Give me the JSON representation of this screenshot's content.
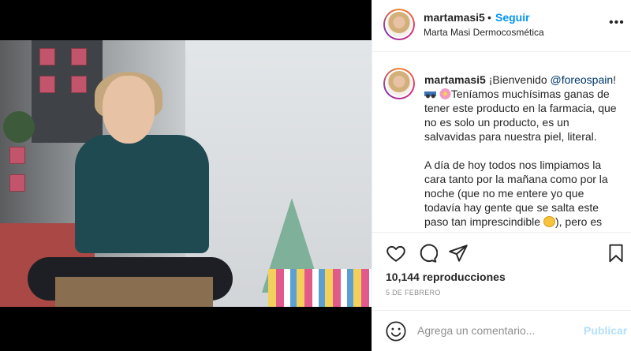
{
  "post": {
    "username": "martamasi5",
    "separator": "•",
    "follow_label": "Seguir",
    "subtitle": "Marta Masi Dermocosmética",
    "more_label": "•••"
  },
  "caption": {
    "username": "martamasi5",
    "greeting": "¡Bienvenido ",
    "mention": "@foreospain",
    "mention_end": "!",
    "line2": "Teníamos muchísimas ganas de tener este producto en la farmacia, que no es solo un producto, es un salvavidas para nuestra piel, literal.",
    "para2_a": "A día de hoy todos nos limpiamos la cara tanto por la mañana como por la noche (que no me entere yo que todavía hay gente que se salta este paso tan imprescindible ",
    "para2_b": "), pero es",
    "emojis": [
      "car-emoji",
      "flower-emoji",
      "smile-emoji"
    ]
  },
  "actions": {
    "icons": [
      "heart-icon",
      "comment-icon",
      "share-icon",
      "bookmark-icon"
    ],
    "views": "10,144 reproducciones",
    "date": "5 DE FEBRERO"
  },
  "comment_box": {
    "placeholder": "Agrega un comentario...",
    "post_label": "Publicar"
  },
  "video": {
    "sound_icon": "speaker-icon"
  },
  "colors": {
    "link": "#0095f6",
    "mention": "#00376b",
    "post_disabled": "#b2dffc",
    "muted": "#8e8e8e"
  }
}
